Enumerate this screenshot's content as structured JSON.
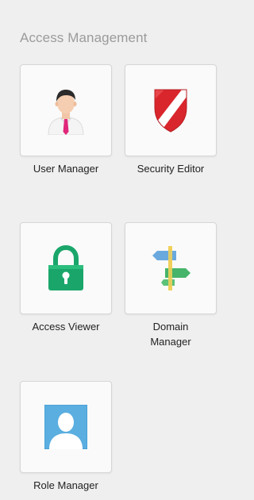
{
  "section": {
    "title": "Access Management"
  },
  "tiles": [
    {
      "label": "User Manager",
      "icon": "user-icon"
    },
    {
      "label": "Security Editor",
      "icon": "shield-icon"
    },
    {
      "label": "Access Viewer",
      "icon": "lock-icon"
    },
    {
      "label": "Domain Manager",
      "icon": "signpost-icon"
    },
    {
      "label": "Role Manager",
      "icon": "role-icon"
    }
  ],
  "colors": {
    "background": "#efefef",
    "title": "#9b9b9b",
    "shield_red": "#d9262c",
    "lock_green": "#1aa66a",
    "role_blue": "#5aaee0"
  }
}
